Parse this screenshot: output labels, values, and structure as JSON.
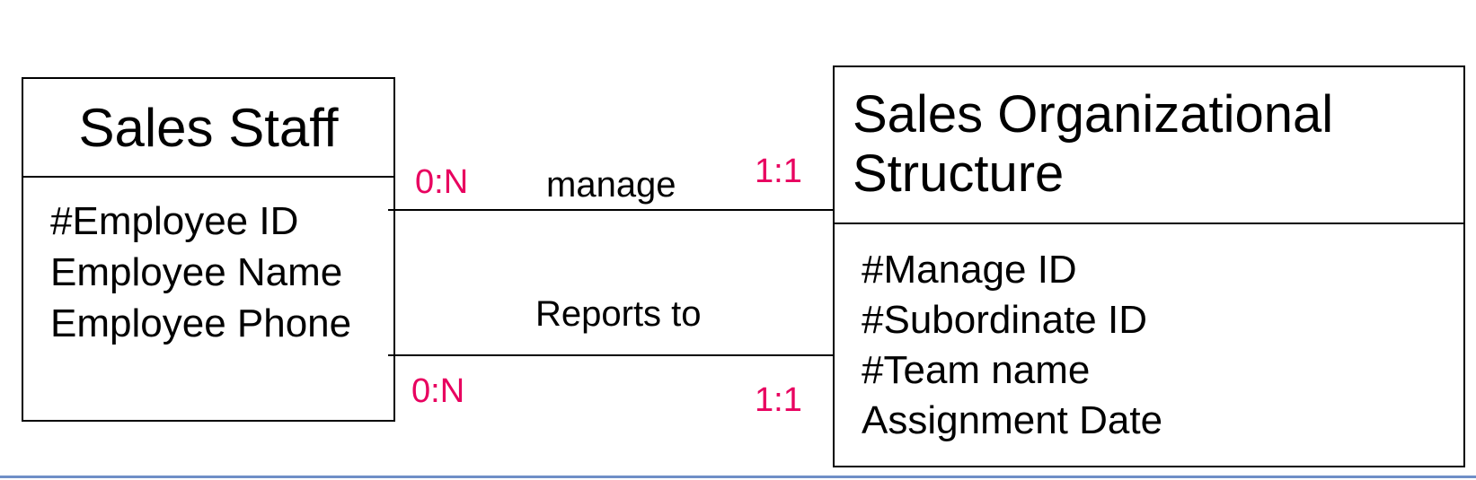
{
  "colors": {
    "cardinality": "#e8005f",
    "bottom_rule": "#6f8fc7"
  },
  "entities": {
    "sales_staff": {
      "title": "Sales Staff",
      "attributes": [
        "#Employee ID",
        "Employee Name",
        "Employee Phone"
      ]
    },
    "sales_org": {
      "title_lines": [
        "Sales Organizational",
        "Structure"
      ],
      "attributes": [
        "#Manage ID",
        "#Subordinate ID",
        "#Team name",
        "Assignment Date"
      ]
    }
  },
  "relationships": {
    "manage": {
      "label": "manage",
      "left_cardinality": "0:N",
      "right_cardinality": "1:1"
    },
    "reports_to": {
      "label": "Reports to",
      "left_cardinality": "0:N",
      "right_cardinality": "1:1"
    }
  }
}
